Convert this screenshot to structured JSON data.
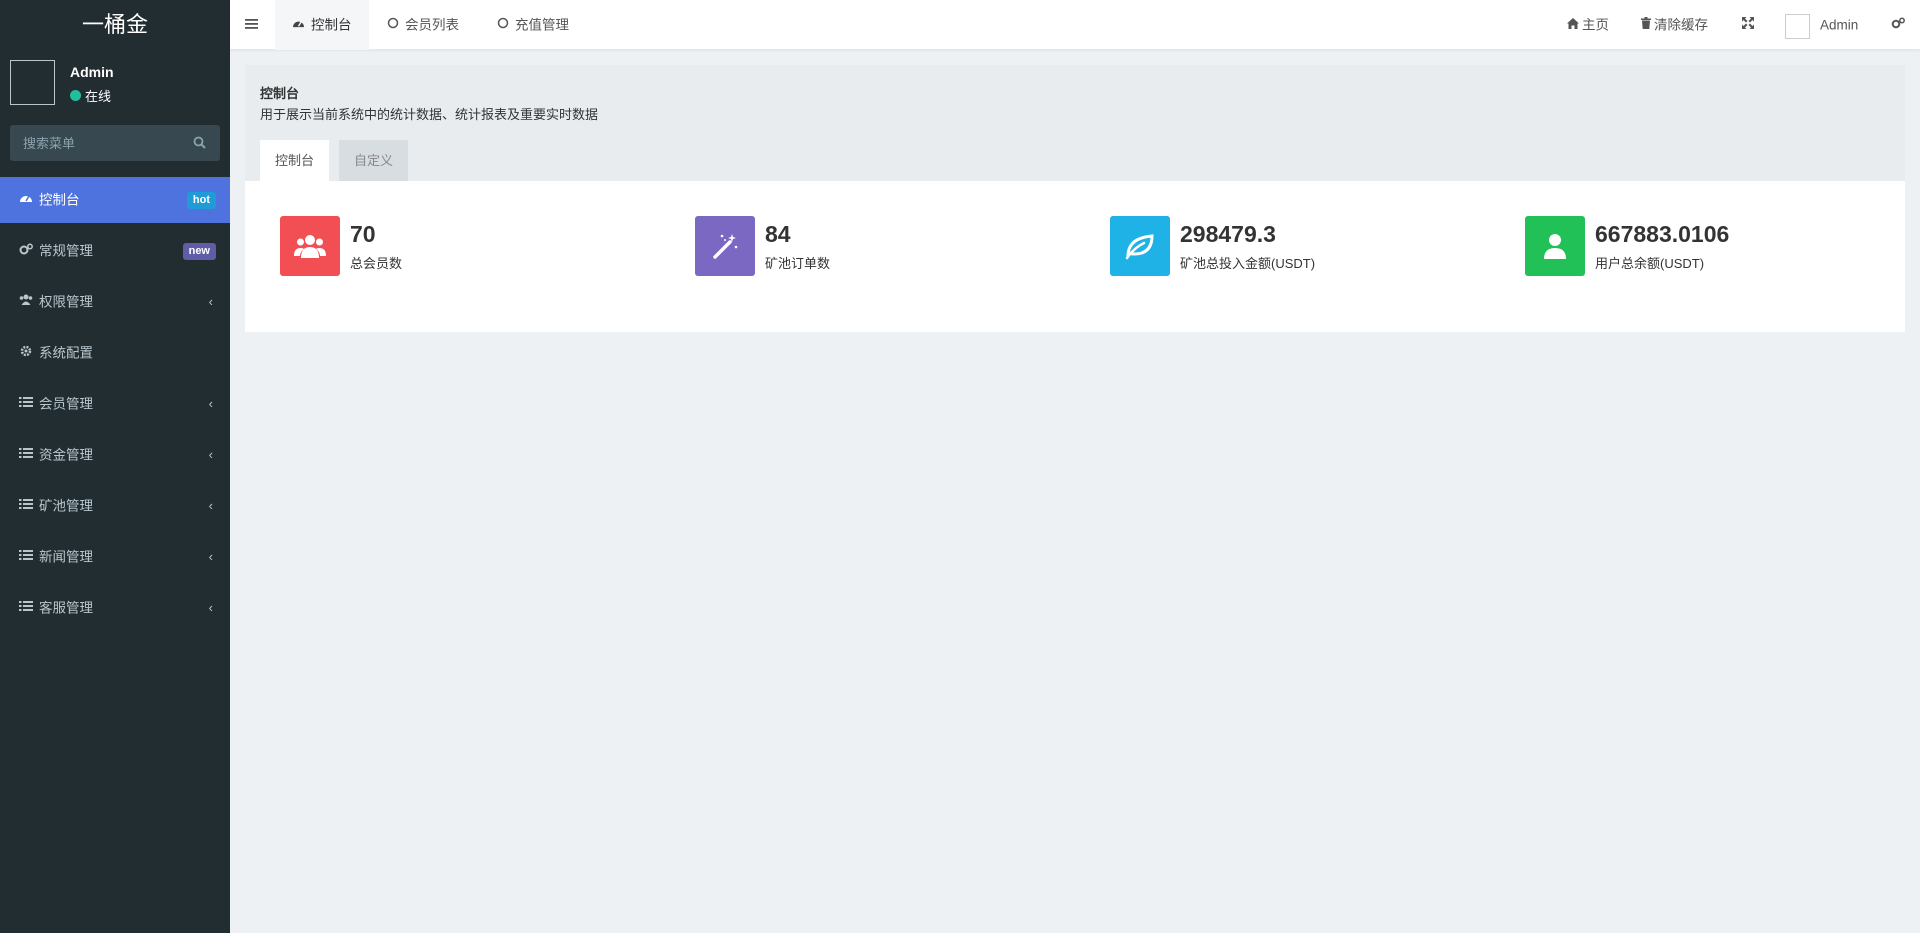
{
  "sidebar": {
    "logo": "一桶金",
    "user": {
      "name": "Admin",
      "status": "在线"
    },
    "search_placeholder": "搜索菜单",
    "items": [
      {
        "label": "控制台",
        "icon": "dashboard-icon",
        "badge": "hot"
      },
      {
        "label": "常规管理",
        "icon": "cogs-icon",
        "badge": "new"
      },
      {
        "label": "权限管理",
        "icon": "users-icon"
      },
      {
        "label": "系统配置",
        "icon": "cog-icon"
      },
      {
        "label": "会员管理",
        "icon": "list-icon"
      },
      {
        "label": "资金管理",
        "icon": "list-icon"
      },
      {
        "label": "矿池管理",
        "icon": "list-icon"
      },
      {
        "label": "新闻管理",
        "icon": "list-icon"
      },
      {
        "label": "客服管理",
        "icon": "list-icon"
      }
    ]
  },
  "header": {
    "tabs": [
      {
        "label": "控制台",
        "icon": "dashboard-icon",
        "active": true
      },
      {
        "label": "会员列表",
        "icon": "circle-icon"
      },
      {
        "label": "充值管理",
        "icon": "circle-icon"
      }
    ],
    "home_label": "主页",
    "clear_cache_label": "清除缓存",
    "admin_label": "Admin"
  },
  "content": {
    "title": "控制台",
    "description": "用于展示当前系统中的统计数据、统计报表及重要实时数据",
    "tabs": [
      "控制台",
      "自定义"
    ],
    "stats": [
      {
        "value": "70",
        "label": "总会员数",
        "color": "#f24f55",
        "icon": "users-icon"
      },
      {
        "value": "84",
        "label": "矿池订单数",
        "color": "#7b68c3",
        "icon": "magic-wand-icon"
      },
      {
        "value": "298479.3",
        "label": "矿池总投入金额(USDT)",
        "color": "#1eb2e6",
        "icon": "leaf-icon"
      },
      {
        "value": "667883.0106",
        "label": "用户总余额(USDT)",
        "color": "#22c157",
        "icon": "user-icon"
      }
    ]
  },
  "colors": {
    "sidebar_bg": "#222d32",
    "active_menu": "#4e73df",
    "badge_hot": "#1f9cd6",
    "badge_new": "#605ca8"
  }
}
